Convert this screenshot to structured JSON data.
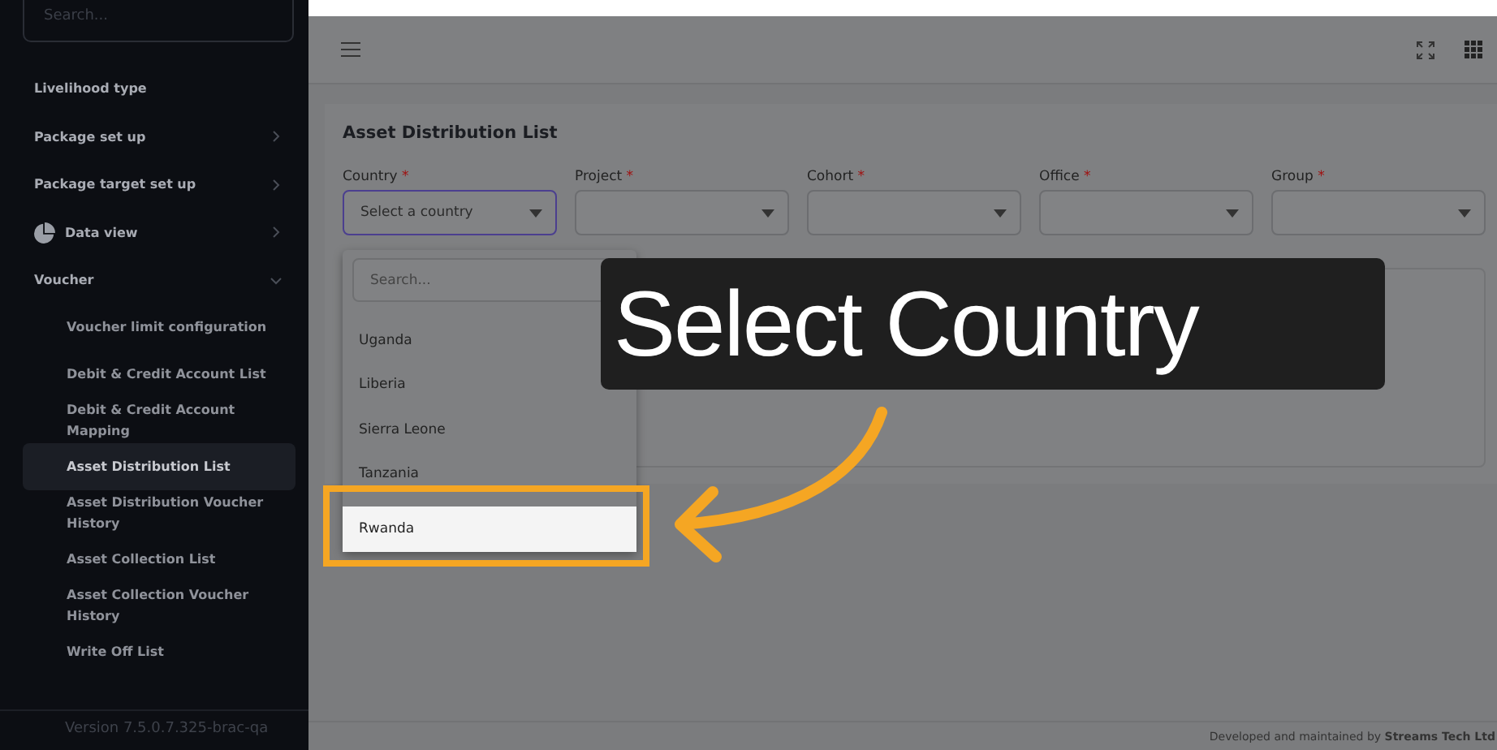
{
  "sidebar": {
    "search_placeholder": "Search...",
    "items": [
      {
        "label": "Livelihood type",
        "kind": "plain"
      },
      {
        "label": "Package set up",
        "kind": "group",
        "expanded": false
      },
      {
        "label": "Package target set up",
        "kind": "group",
        "expanded": false
      },
      {
        "label": "Data view",
        "kind": "group",
        "expanded": false
      },
      {
        "label": "Voucher",
        "kind": "group",
        "expanded": true,
        "children": [
          {
            "label": "Voucher limit configuration",
            "selected": false
          },
          {
            "label": "Debit & Credit Account List",
            "selected": false
          },
          {
            "label": "Debit & Credit Account Mapping",
            "selected": false
          },
          {
            "label": "Asset Distribution List",
            "selected": true
          },
          {
            "label": "Asset Distribution Voucher History",
            "selected": false
          },
          {
            "label": "Asset Collection List",
            "selected": false
          },
          {
            "label": "Asset Collection Voucher History",
            "selected": false
          },
          {
            "label": "Write Off List",
            "selected": false
          }
        ]
      }
    ],
    "version": "Version 7.5.0.7.325-brac-qa"
  },
  "page": {
    "title": "Asset Distribution List",
    "filters": [
      {
        "label": "Country",
        "required_mark": "*",
        "placeholder": "Select a country",
        "focused": true
      },
      {
        "label": "Project",
        "required_mark": "*",
        "focused": false
      },
      {
        "label": "Cohort",
        "required_mark": "*",
        "focused": false
      },
      {
        "label": "Office",
        "required_mark": "*",
        "focused": false
      },
      {
        "label": "Group",
        "required_mark": "*",
        "focused": false
      }
    ],
    "dropdown": {
      "search_placeholder": "Search...",
      "options": [
        {
          "label": "Uganda",
          "selected": false
        },
        {
          "label": "Liberia",
          "selected": false
        },
        {
          "label": "Sierra Leone",
          "selected": false
        },
        {
          "label": "Tanzania",
          "selected": false
        },
        {
          "label": "Rwanda",
          "selected": true
        }
      ]
    }
  },
  "callout": {
    "text": "Select Country"
  },
  "footer": {
    "text": "Developed and maintained by **Streams Tech Ltd**"
  }
}
